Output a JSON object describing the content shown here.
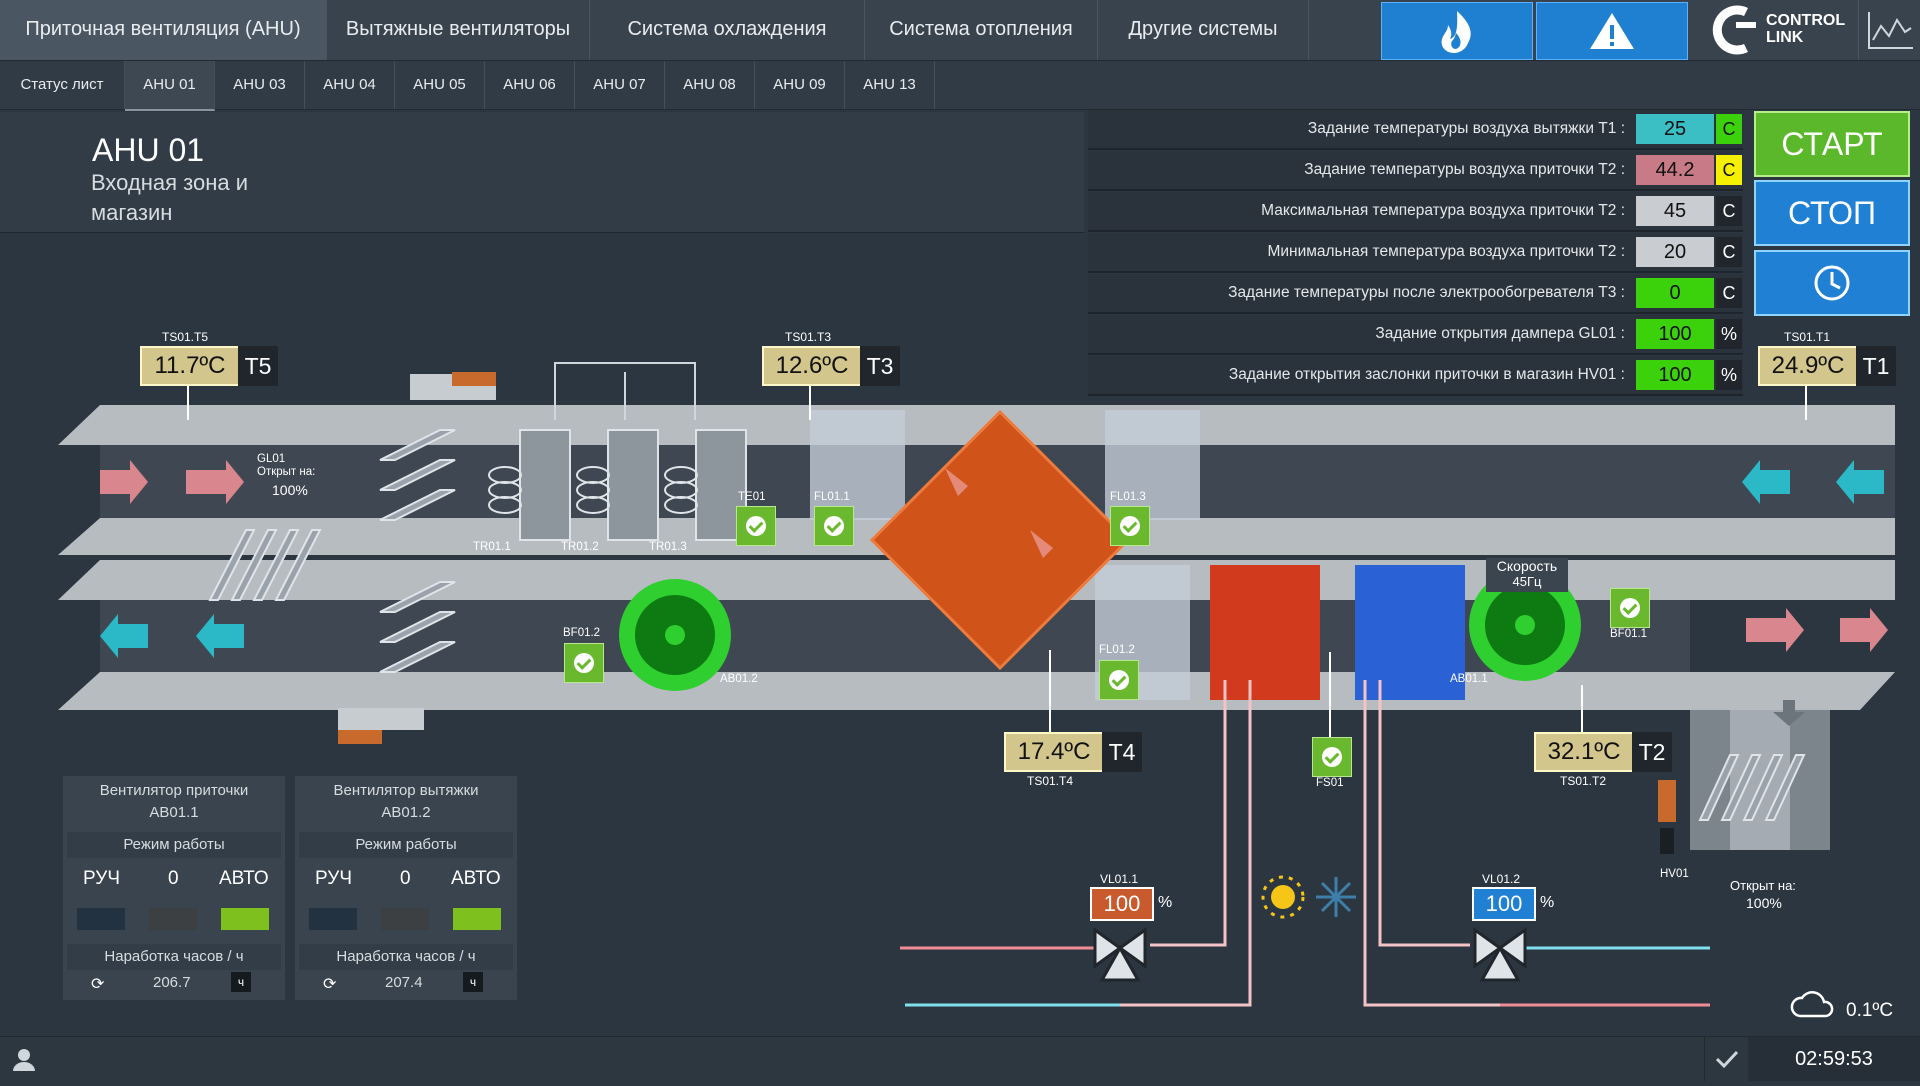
{
  "nav": {
    "tabs": [
      "Приточная вентиляция (AHU)",
      "Вытяжные вентиляторы",
      "Система охлаждения",
      "Система отопления",
      "Другие системы"
    ],
    "brand_line1": "CONTROL",
    "brand_line2": "LINK"
  },
  "subnav": {
    "tabs": [
      "Статус лист",
      "AHU 01",
      "AHU 03",
      "AHU 04",
      "AHU 05",
      "AHU 06",
      "AHU 07",
      "AHU 08",
      "AHU 09",
      "AHU 13"
    ]
  },
  "header": {
    "title": "AHU 01",
    "subtitle_1": "Входная зона и",
    "subtitle_2": "магазин"
  },
  "settings": [
    {
      "label": "Задание температуры воздуха вытяжки Т1 :",
      "value": "25",
      "unit": "C",
      "value_color": "#3bbfc4",
      "unit_color": "#3bd20b"
    },
    {
      "label": "Задание температуры воздуха приточки Т2 :",
      "value": "44.2",
      "unit": "C",
      "value_color": "#c87a86",
      "unit_color": "#f5f000"
    },
    {
      "label": "Максимальная температура воздуха приточки Т2 :",
      "value": "45",
      "unit": "C",
      "value_color": "#c9ccd0",
      "unit_color": "#20262c"
    },
    {
      "label": "Минимальная температура воздуха приточки Т2 :",
      "value": "20",
      "unit": "C",
      "value_color": "#c9ccd0",
      "unit_color": "#20262c"
    },
    {
      "label": "Задание температуры после  электрообогревателя Т3 :",
      "value": "0",
      "unit": "C",
      "value_color": "#3bd20b",
      "unit_color": "#20262c"
    },
    {
      "label": "Задание открытия дампера GL01 :",
      "value": "100",
      "unit": "%",
      "value_color": "#3bd20b",
      "unit_color": "#20262c"
    },
    {
      "label": "Задание открытия заслонки приточки в магазин HV01 :",
      "value": "100",
      "unit": "%",
      "value_color": "#3bd20b",
      "unit_color": "#20262c"
    }
  ],
  "buttons": {
    "start": "СТАРТ",
    "stop": "СТОП"
  },
  "sensors": {
    "t5": {
      "id": "TS01.T5",
      "value": "11.7ºC",
      "sym": "T5"
    },
    "t3": {
      "id": "TS01.T3",
      "value": "12.6ºC",
      "sym": "T3"
    },
    "t1": {
      "id": "TS01.T1",
      "value": "24.9ºC",
      "sym": "T1"
    },
    "t4": {
      "id": "TS01.T4",
      "value": "17.4ºC",
      "sym": "T4"
    },
    "t2": {
      "id": "TS01.T2",
      "value": "32.1ºC",
      "sym": "T2"
    }
  },
  "labels": {
    "gl01": "GL01",
    "gl01_open": "Открыт на:",
    "gl01_pct": "100%",
    "tr1": "TR01.1",
    "tr2": "TR01.2",
    "tr3": "TR01.3",
    "te01": "TE01",
    "fl011": "FL01.1",
    "fl013": "FL01.3",
    "fl012": "FL01.2",
    "bf012": "BF01.2",
    "ab012": "AB01.2",
    "bf011": "BF01.1",
    "ab011": "AB01.1",
    "speed": "Скорость",
    "speed_val": "45Гц",
    "fs01": "FS01",
    "hv01": "HV01",
    "hv_open": "Открыт на:",
    "hv_pct": "100%"
  },
  "valves": {
    "vl011": {
      "id": "VL01.1",
      "value": "100",
      "unit": "%"
    },
    "vl012": {
      "id": "VL01.2",
      "value": "100",
      "unit": "%"
    }
  },
  "fan_supply": {
    "title": "Вентилятор приточки",
    "id": "AB01.1",
    "mode_label": "Режим работы",
    "m1": "РУЧ",
    "m2": "0",
    "m3": "АВТО",
    "hours_label": "Наработка часов / ч",
    "hours": "206.7",
    "hours_unit": "ч"
  },
  "fan_exhaust": {
    "title": "Вентилятор вытяжки",
    "id": "AB01.2",
    "mode_label": "Режим работы",
    "m1": "РУЧ",
    "m2": "0",
    "m3": "АВТО",
    "hours_label": "Наработка часов / ч",
    "hours": "207.4",
    "hours_unit": "ч"
  },
  "weather": {
    "outdoor": "0.1ºC"
  },
  "status": {
    "time": "02:59:53"
  }
}
